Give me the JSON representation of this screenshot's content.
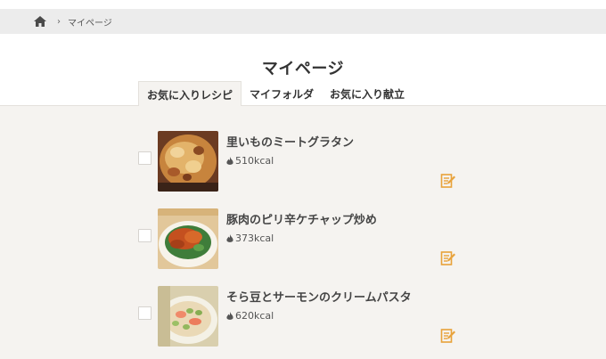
{
  "breadcrumb": {
    "home_icon": "home-icon",
    "separator_icon": "chevron-right-icon",
    "current": "マイページ"
  },
  "page": {
    "title": "マイページ"
  },
  "tabs": [
    {
      "label": "お気に入りレシピ",
      "active": true
    },
    {
      "label": "マイフォルダ",
      "active": false
    },
    {
      "label": "お気に入り献立",
      "active": false
    }
  ],
  "recipes": [
    {
      "name": "里いものミートグラタン",
      "kcal": "510kcal",
      "checked": false
    },
    {
      "name": "豚肉のピリ辛ケチャップ炒め",
      "kcal": "373kcal",
      "checked": false
    },
    {
      "name": "そら豆とサーモンのクリームパスタ",
      "kcal": "620kcal",
      "checked": false
    }
  ],
  "colors": {
    "accent": "#e8a23a",
    "background": "#f5f3f0",
    "breadcrumb_bg": "#ececec"
  }
}
